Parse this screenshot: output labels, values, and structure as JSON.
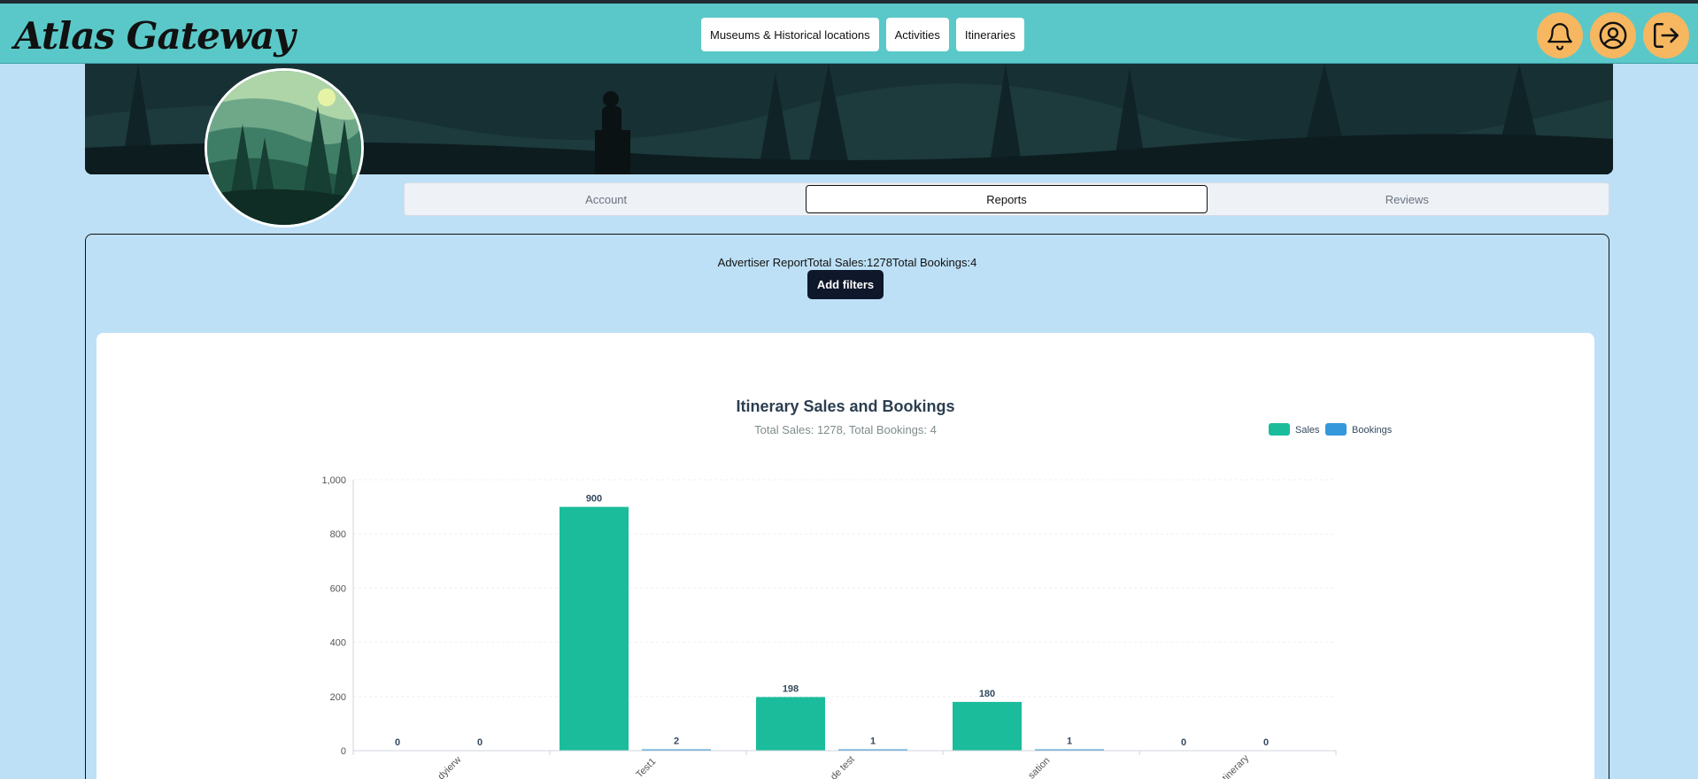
{
  "brand": {
    "logo_text": "Atlas Gateway"
  },
  "nav": {
    "links": [
      "Museums & Historical locations",
      "Activities",
      "Itineraries"
    ],
    "icons": [
      "bell-icon",
      "user-circle-icon",
      "logout-icon"
    ]
  },
  "tabs": [
    {
      "label": "Account",
      "active": false
    },
    {
      "label": "Reports",
      "active": true
    },
    {
      "label": "Reviews",
      "active": false
    }
  ],
  "report": {
    "line": "Advertiser ReportTotal Sales:1278Total Bookings:4",
    "add_filters_label": "Add filters"
  },
  "colors": {
    "navbar": "#5ac8c8",
    "icon_button": "#f6b760",
    "sales": "#1abc9c",
    "bookings": "#3498db"
  },
  "chart_data": {
    "type": "bar",
    "title": "Itinerary Sales and Bookings",
    "subtitle": "Total Sales: 1278, Total Bookings: 4",
    "categories": [
      "dyierw",
      "Test1",
      "de test",
      "sation",
      "tinerary"
    ],
    "series": [
      {
        "name": "Sales",
        "values": [
          0,
          900,
          198,
          180,
          0
        ],
        "color": "#1abc9c"
      },
      {
        "name": "Bookings",
        "values": [
          0,
          2,
          1,
          1,
          0
        ],
        "color": "#3498db"
      }
    ],
    "yticks": [
      "0",
      "200",
      "400",
      "600",
      "800",
      "1,000"
    ],
    "ylim": [
      0,
      1000
    ],
    "legend": "top-right",
    "grid": true
  }
}
